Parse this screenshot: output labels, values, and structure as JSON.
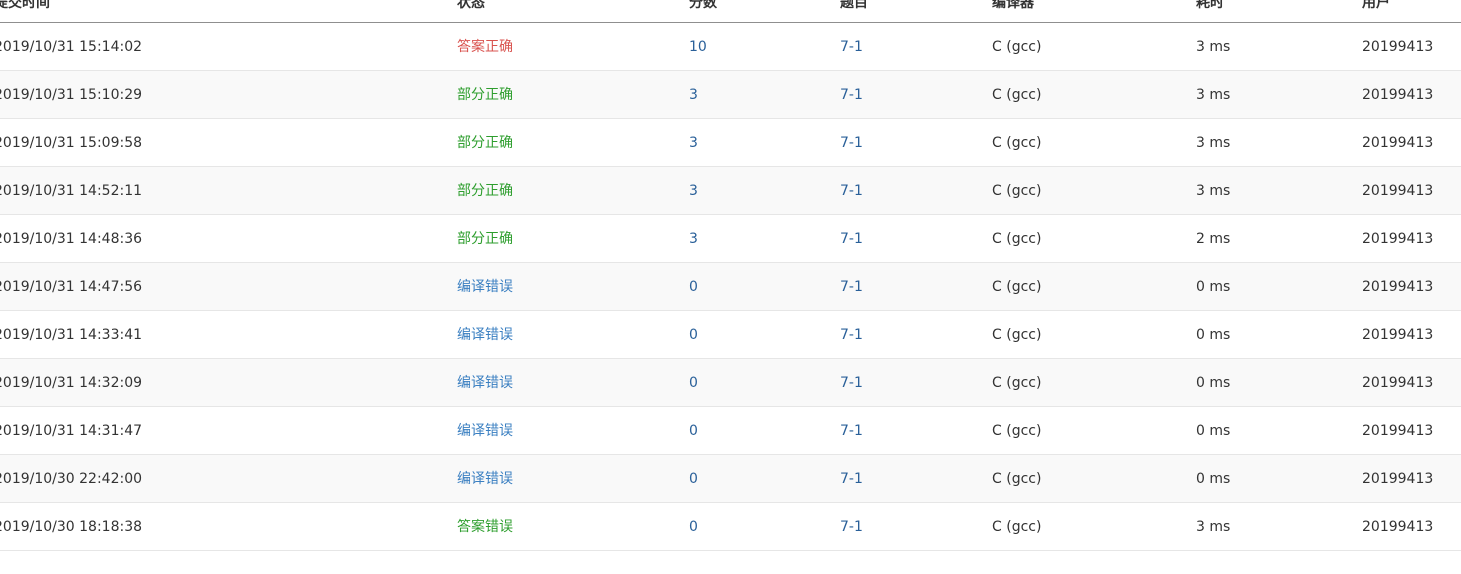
{
  "table": {
    "headers": {
      "submit_time": "提交时间",
      "status": "状态",
      "score": "分数",
      "problem": "题目",
      "compiler": "编译器",
      "time_cost": "耗时",
      "user": "用户"
    },
    "rows": [
      {
        "submit_time": "2019/10/31 15:14:02",
        "status": "答案正确",
        "status_type": "accepted",
        "score": "10",
        "problem": "7-1",
        "compiler": "C (gcc)",
        "time_cost": "3 ms",
        "user": "20199413"
      },
      {
        "submit_time": "2019/10/31 15:10:29",
        "status": "部分正确",
        "status_type": "partial",
        "score": "3",
        "problem": "7-1",
        "compiler": "C (gcc)",
        "time_cost": "3 ms",
        "user": "20199413"
      },
      {
        "submit_time": "2019/10/31 15:09:58",
        "status": "部分正确",
        "status_type": "partial",
        "score": "3",
        "problem": "7-1",
        "compiler": "C (gcc)",
        "time_cost": "3 ms",
        "user": "20199413"
      },
      {
        "submit_time": "2019/10/31 14:52:11",
        "status": "部分正确",
        "status_type": "partial",
        "score": "3",
        "problem": "7-1",
        "compiler": "C (gcc)",
        "time_cost": "3 ms",
        "user": "20199413"
      },
      {
        "submit_time": "2019/10/31 14:48:36",
        "status": "部分正确",
        "status_type": "partial",
        "score": "3",
        "problem": "7-1",
        "compiler": "C (gcc)",
        "time_cost": "2 ms",
        "user": "20199413"
      },
      {
        "submit_time": "2019/10/31 14:47:56",
        "status": "编译错误",
        "status_type": "compile-error",
        "score": "0",
        "problem": "7-1",
        "compiler": "C (gcc)",
        "time_cost": "0 ms",
        "user": "20199413"
      },
      {
        "submit_time": "2019/10/31 14:33:41",
        "status": "编译错误",
        "status_type": "compile-error",
        "score": "0",
        "problem": "7-1",
        "compiler": "C (gcc)",
        "time_cost": "0 ms",
        "user": "20199413"
      },
      {
        "submit_time": "2019/10/31 14:32:09",
        "status": "编译错误",
        "status_type": "compile-error",
        "score": "0",
        "problem": "7-1",
        "compiler": "C (gcc)",
        "time_cost": "0 ms",
        "user": "20199413"
      },
      {
        "submit_time": "2019/10/31 14:31:47",
        "status": "编译错误",
        "status_type": "compile-error",
        "score": "0",
        "problem": "7-1",
        "compiler": "C (gcc)",
        "time_cost": "0 ms",
        "user": "20199413"
      },
      {
        "submit_time": "2019/10/30 22:42:00",
        "status": "编译错误",
        "status_type": "compile-error",
        "score": "0",
        "problem": "7-1",
        "compiler": "C (gcc)",
        "time_cost": "0 ms",
        "user": "20199413"
      },
      {
        "submit_time": "2019/10/30 18:18:38",
        "status": "答案错误",
        "status_type": "wrong",
        "score": "0",
        "problem": "7-1",
        "compiler": "C (gcc)",
        "time_cost": "3 ms",
        "user": "20199413"
      }
    ]
  },
  "colors": {
    "accepted": "#d9534f",
    "partial": "#2e9e2e",
    "compile_error": "#3a7fc1",
    "wrong": "#2e9e2e",
    "link": "#2a6099",
    "row_alt": "#f9f9f9"
  }
}
